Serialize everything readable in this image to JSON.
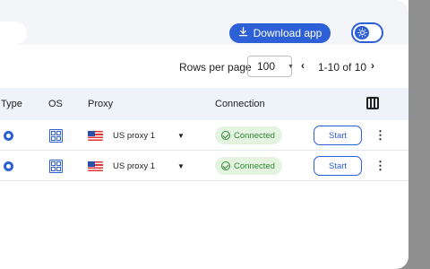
{
  "header": {
    "download_label": "Download app",
    "download_icon": "download-icon",
    "theme_icon": "sun-icon",
    "accent": "#2d5fd6"
  },
  "pagination": {
    "rows_per_page_label": "Rows per page",
    "rows_per_page_value": "100",
    "prev_glyph": "‹",
    "range": "1-10 of 10",
    "next_glyph": "›"
  },
  "table": {
    "columns": [
      "Type",
      "OS",
      "Proxy",
      "Connection"
    ],
    "columns_icon": "columns-icon",
    "rows": [
      {
        "browser_icon": "browser-icon",
        "os_icon": "windows-icon",
        "flag": "us-flag-icon",
        "proxy": "US proxy 1",
        "proxy_caret": "▼",
        "connection": "Connected",
        "action": "Start",
        "more": "⋮"
      },
      {
        "browser_icon": "browser-icon",
        "os_icon": "windows-icon",
        "flag": "us-flag-icon",
        "proxy": "US proxy 1",
        "proxy_caret": "▼",
        "connection": "Connected",
        "action": "Start",
        "more": "⋮"
      }
    ]
  },
  "colors": {
    "status_ok_bg": "#e4f4e1",
    "status_ok_fg": "#2f8a31",
    "header_bg": "#eef2f9"
  }
}
